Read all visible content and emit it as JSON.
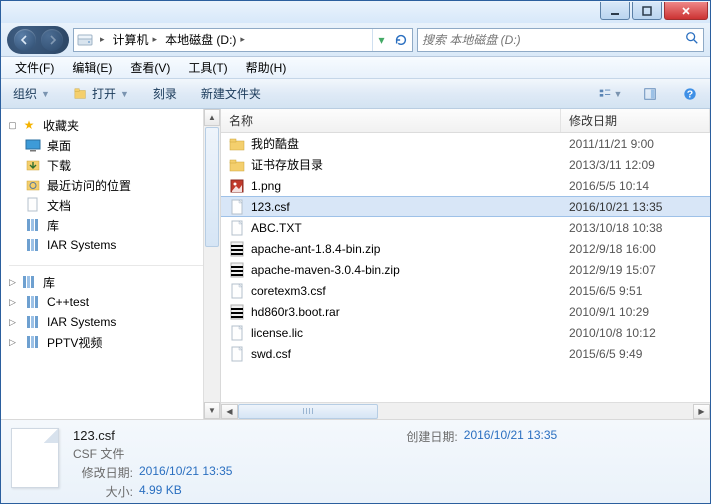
{
  "titlebar": {
    "min": "",
    "max": "",
    "close": ""
  },
  "nav": {
    "crumbs": {
      "computer": "计算机",
      "drive": "本地磁盘 (D:)"
    }
  },
  "search": {
    "placeholder": "搜索 本地磁盘 (D:)"
  },
  "menubar": {
    "file": "文件(F)",
    "edit": "编辑(E)",
    "view": "查看(V)",
    "tools": "工具(T)",
    "help": "帮助(H)"
  },
  "toolbar": {
    "organize": "组织",
    "open": "打开",
    "burn": "刻录",
    "newfolder": "新建文件夹"
  },
  "navpane": {
    "favorites": {
      "label": "收藏夹",
      "items": [
        "桌面",
        "下载",
        "最近访问的位置",
        "文档",
        "库",
        "IAR Systems"
      ]
    },
    "libraries": {
      "label": "库",
      "items": [
        "C++test",
        "IAR Systems",
        "PPTV视频"
      ]
    }
  },
  "columns": {
    "name": "名称",
    "date": "修改日期"
  },
  "files": [
    {
      "icon": "folder",
      "name": "我的酷盘",
      "date": "2011/11/21 9:00",
      "sel": false
    },
    {
      "icon": "folder",
      "name": "证书存放目录",
      "date": "2013/3/11 12:09",
      "sel": false
    },
    {
      "icon": "png",
      "name": "1.png",
      "date": "2016/5/5 10:14",
      "sel": false
    },
    {
      "icon": "file",
      "name": "123.csf",
      "date": "2016/10/21 13:35",
      "sel": true
    },
    {
      "icon": "file",
      "name": "ABC.TXT",
      "date": "2013/10/18 10:38",
      "sel": false
    },
    {
      "icon": "rar",
      "name": "apache-ant-1.8.4-bin.zip",
      "date": "2012/9/18 16:00",
      "sel": false
    },
    {
      "icon": "rar",
      "name": "apache-maven-3.0.4-bin.zip",
      "date": "2012/9/19 15:07",
      "sel": false
    },
    {
      "icon": "file",
      "name": "coretexm3.csf",
      "date": "2015/6/5 9:51",
      "sel": false
    },
    {
      "icon": "rar",
      "name": "hd860r3.boot.rar",
      "date": "2010/9/1 10:29",
      "sel": false
    },
    {
      "icon": "file",
      "name": "license.lic",
      "date": "2010/10/8 10:12",
      "sel": false
    },
    {
      "icon": "file",
      "name": "swd.csf",
      "date": "2015/6/5 9:49",
      "sel": false
    }
  ],
  "details": {
    "filename": "123.csf",
    "filetype": "CSF 文件",
    "mdate_label": "修改日期:",
    "mdate": "2016/10/21 13:35",
    "size_label": "大小:",
    "size": "4.99 KB",
    "cdate_label": "创建日期:",
    "cdate": "2016/10/21 13:35"
  }
}
